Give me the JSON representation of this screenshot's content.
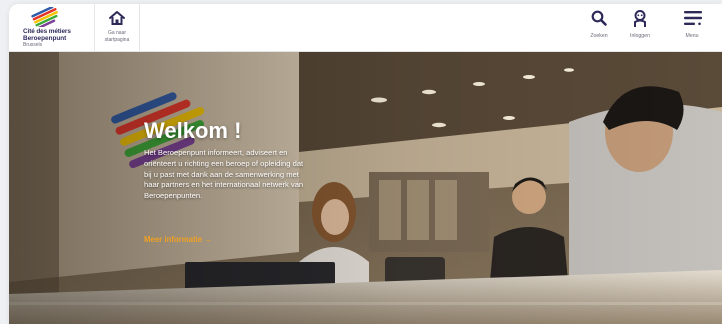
{
  "colors": {
    "brand_navy": "#2d2a5a",
    "accent_orange": "#f0a020",
    "stripe_yellow": "#f5c400",
    "stripe_red": "#e63328",
    "stripe_blue": "#2f5aa8",
    "stripe_green": "#3aaa35",
    "stripe_purple": "#7b3f98"
  },
  "header": {
    "logo": {
      "line1": "Cité des métiers",
      "line2": "Beroepenpunt",
      "line3": "Brussels"
    },
    "home_link": {
      "label_line1": "Ga naar",
      "label_line2": "startpagina",
      "icon": "home-icon"
    },
    "actions": [
      {
        "label": "Zoeken",
        "icon": "search-icon"
      },
      {
        "label": "Inloggen",
        "icon": "user-icon"
      },
      {
        "label": "Menu",
        "icon": "hamburger-menu-icon"
      }
    ]
  },
  "hero": {
    "title": "Welkom !",
    "body": "Het Beroepenpunt informeert, adviseert en oriënteert u richting een beroep of opleiding dat bij u past met dank aan de samenwerking met haar partners en het internationaal netwerk van Beroepenpunten.",
    "more_link": "Meer informatie →",
    "background": "photo of a reception desk with staff and a visitor"
  }
}
